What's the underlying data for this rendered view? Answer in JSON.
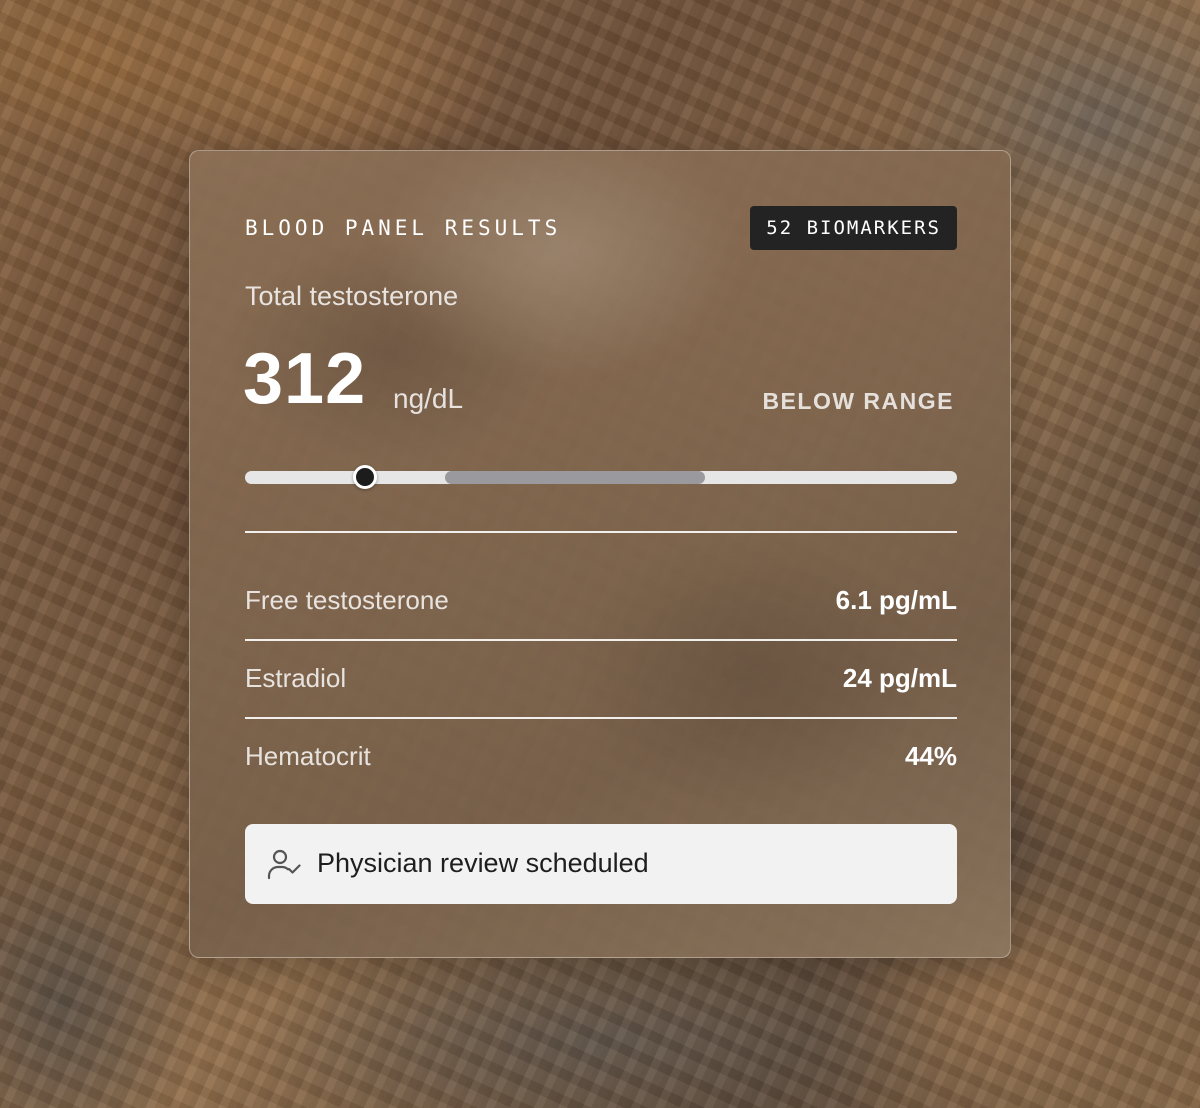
{
  "panel": {
    "title": "BLOOD PANEL RESULTS",
    "badge": "52 BIOMARKERS"
  },
  "primary_metric": {
    "label": "Total testosterone",
    "value": "312",
    "unit": "ng/dL",
    "status": "BELOW RANGE",
    "range_position_fraction": 0.168,
    "optimal_start_fraction": 0.281,
    "optimal_end_fraction": 0.646
  },
  "biomarkers": [
    {
      "label": "Free testosterone",
      "value": "6.1 pg/mL"
    },
    {
      "label": "Estradiol",
      "value": "24 pg/mL"
    },
    {
      "label": "Hematocrit",
      "value": "44%"
    }
  ],
  "review": {
    "icon": "user-check-icon",
    "text": "Physician review scheduled"
  },
  "colors": {
    "badge_bg": "#232323",
    "track": "#e6e6e6",
    "optimal_range": "#9a9a9e",
    "marker": "#1c1c1c",
    "review_bg": "#f2f2f2"
  }
}
